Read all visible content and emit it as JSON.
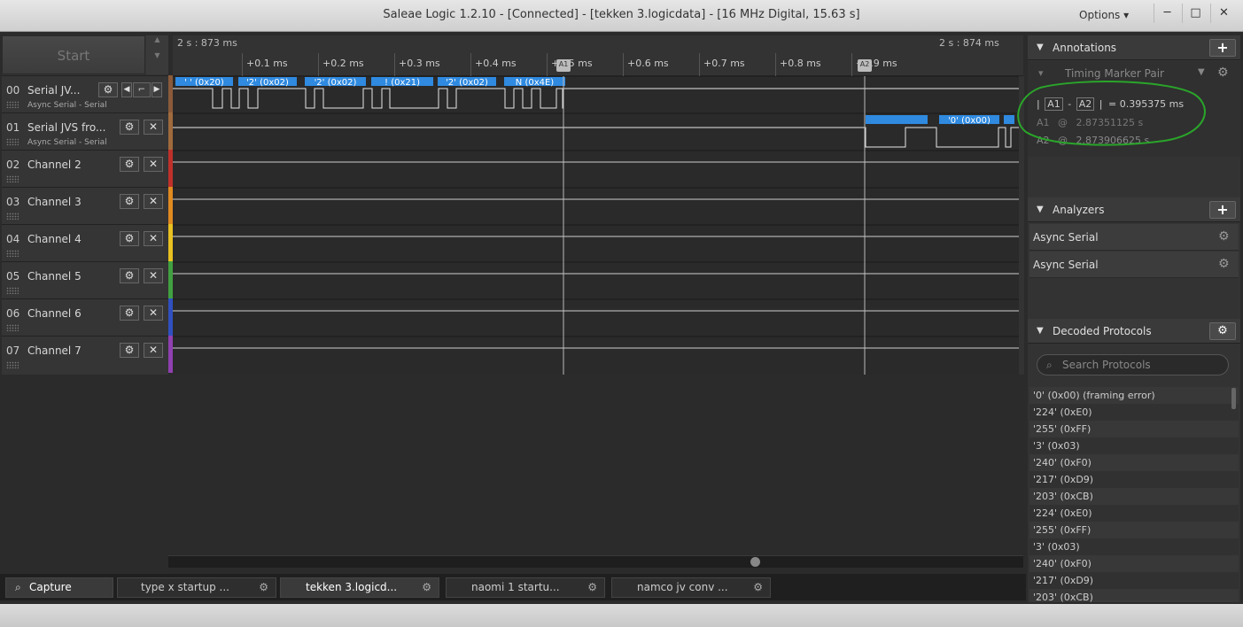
{
  "window": {
    "title": "Saleae Logic 1.2.10 - [Connected] - [tekken 3.logicdata] - [16 MHz Digital, 15.63 s]",
    "options_label": "Options ▾",
    "minimize": "─",
    "maximize": "□",
    "close": "✕"
  },
  "start_button": "Start",
  "channels": [
    {
      "num": "00",
      "name": "Serial JV...",
      "sub": "Async Serial - Serial",
      "color": "#8a5a3a"
    },
    {
      "num": "01",
      "name": "Serial JVS fro...",
      "sub": "Async Serial - Serial",
      "color": "#a06a3c"
    },
    {
      "num": "02",
      "name": "Channel 2",
      "sub": "",
      "color": "#c0302a"
    },
    {
      "num": "03",
      "name": "Channel 3",
      "sub": "",
      "color": "#e08a20"
    },
    {
      "num": "04",
      "name": "Channel 4",
      "sub": "",
      "color": "#e8c020"
    },
    {
      "num": "05",
      "name": "Channel 5",
      "sub": "",
      "color": "#40a040"
    },
    {
      "num": "06",
      "name": "Channel 6",
      "sub": "",
      "color": "#3050c0"
    },
    {
      "num": "07",
      "name": "Channel 7",
      "sub": "",
      "color": "#9040b0"
    }
  ],
  "timeline": {
    "left_time": "2 s : 873 ms",
    "right_time": "2 s : 874 ms",
    "ticks": [
      "+0.1 ms",
      "+0.2 ms",
      "+0.3 ms",
      "+0.4 ms",
      "+0.5 ms",
      "+0.6 ms",
      "+0.7 ms",
      "+0.8 ms",
      "+0.9 ms"
    ],
    "marker_a1": "A1",
    "marker_a2": "A2"
  },
  "decoded_ch0": [
    "' ' (0x20)",
    "'2' (0x02)",
    "'2' (0x02)",
    "! (0x21)",
    "'2' (0x02)",
    "N (0x4E)"
  ],
  "decoded_ch1": [
    "'0' (0x00)"
  ],
  "tabs": [
    {
      "label": "Capture",
      "icon": "capture-icon"
    },
    {
      "label": "type x startup ..."
    },
    {
      "label": "tekken 3.logicd..."
    },
    {
      "label": "naomi 1 startu..."
    },
    {
      "label": "namco jv conv ..."
    }
  ],
  "annotations": {
    "title": "Annotations",
    "pair_label": "Timing Marker Pair",
    "a1": "A1",
    "a2": "A2",
    "delta": "= 0.395375 ms",
    "a1_time": "2.87351125 s",
    "a2_time": "2.873906625 s",
    "at": "@"
  },
  "analyzers": {
    "title": "Analyzers",
    "items": [
      "Async Serial",
      "Async Serial"
    ]
  },
  "decoded_protocols": {
    "title": "Decoded Protocols",
    "search_placeholder": "Search Protocols",
    "items": [
      "'0' (0x00) (framing error)",
      "'224' (0xE0)",
      "'255' (0xFF)",
      "'3' (0x03)",
      "'240' (0xF0)",
      "'217' (0xD9)",
      "'203' (0xCB)",
      "'224' (0xE0)",
      "'255' (0xFF)",
      "'3' (0x03)",
      "'240' (0xF0)",
      "'217' (0xD9)",
      "'203' (0xCB)"
    ]
  }
}
